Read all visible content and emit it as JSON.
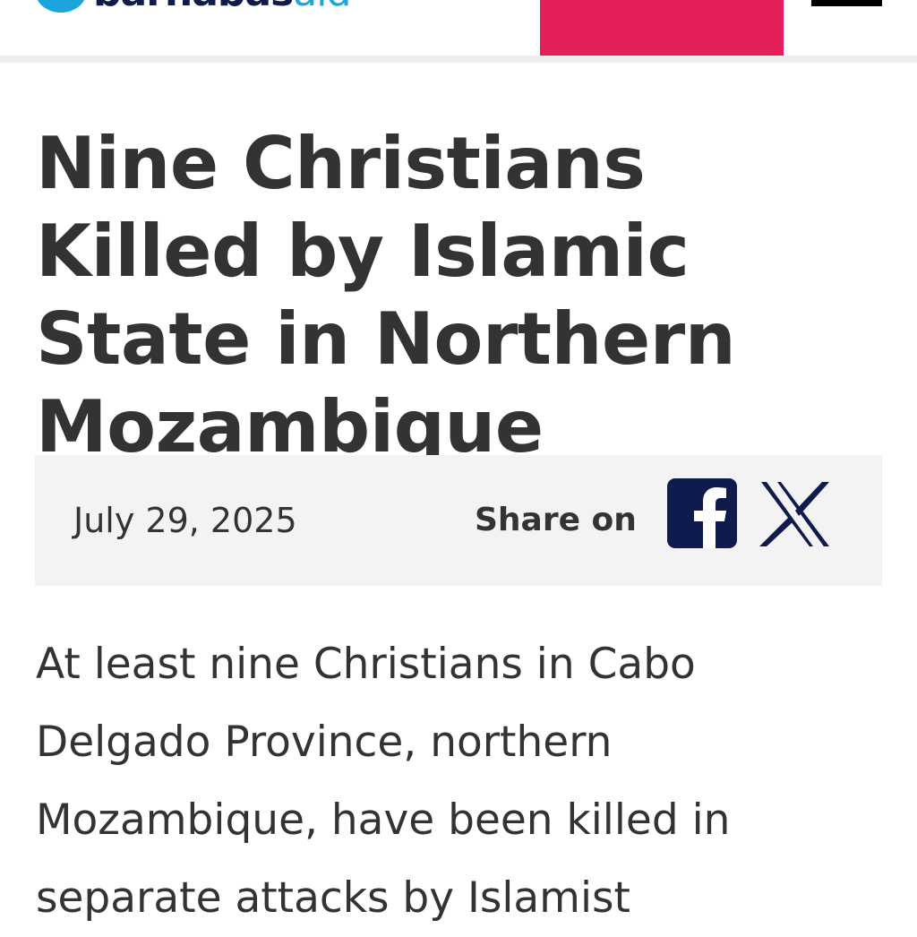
{
  "header": {
    "logo": {
      "name": "barnabas",
      "suffix": "aid"
    },
    "colors": {
      "brand_navy": "#0f1a4d",
      "brand_blue": "#1ea4dc",
      "donate_pink": "#e31f5a"
    }
  },
  "article": {
    "title": "Nine Christians Killed by Islamic State in Northern Mozambique",
    "date": "July 29, 2025",
    "share_label": "Share on",
    "share_icons": [
      "facebook-icon",
      "x-icon"
    ],
    "body": "At least nine Christians in Cabo Delgado Province, northern Mozambique, have been killed in separate attacks by Islamist"
  }
}
